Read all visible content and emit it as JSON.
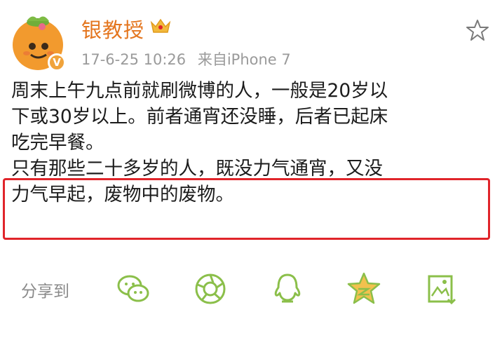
{
  "header": {
    "username": "银教授",
    "timestamp": "17-6-25 10:26",
    "source": "来自iPhone 7",
    "verified_badge": "V",
    "avatar_icon": "orange-character-avatar",
    "crown_icon": "member-crown-icon",
    "favorite_icon": "star-outline-icon"
  },
  "post": {
    "lines": [
      "周末上午九点前就刷微博的人，一般是20岁以",
      "下或30岁以上。前者通宵还没睡，后者已起床",
      "吃完早餐。",
      "只有那些二十多岁的人，既没力气通宵，又没",
      "力气早起，废物中的废物。"
    ],
    "highlight_color": "#e0242a"
  },
  "share": {
    "label": "分享到",
    "targets": [
      "wechat-icon",
      "moments-icon",
      "qq-icon",
      "qzone-icon",
      "save-image-icon"
    ],
    "icon_color": "#8bbf4a"
  },
  "colors": {
    "username": "#e4761f",
    "meta": "#9a9a9a",
    "text": "#1c1c1c"
  }
}
